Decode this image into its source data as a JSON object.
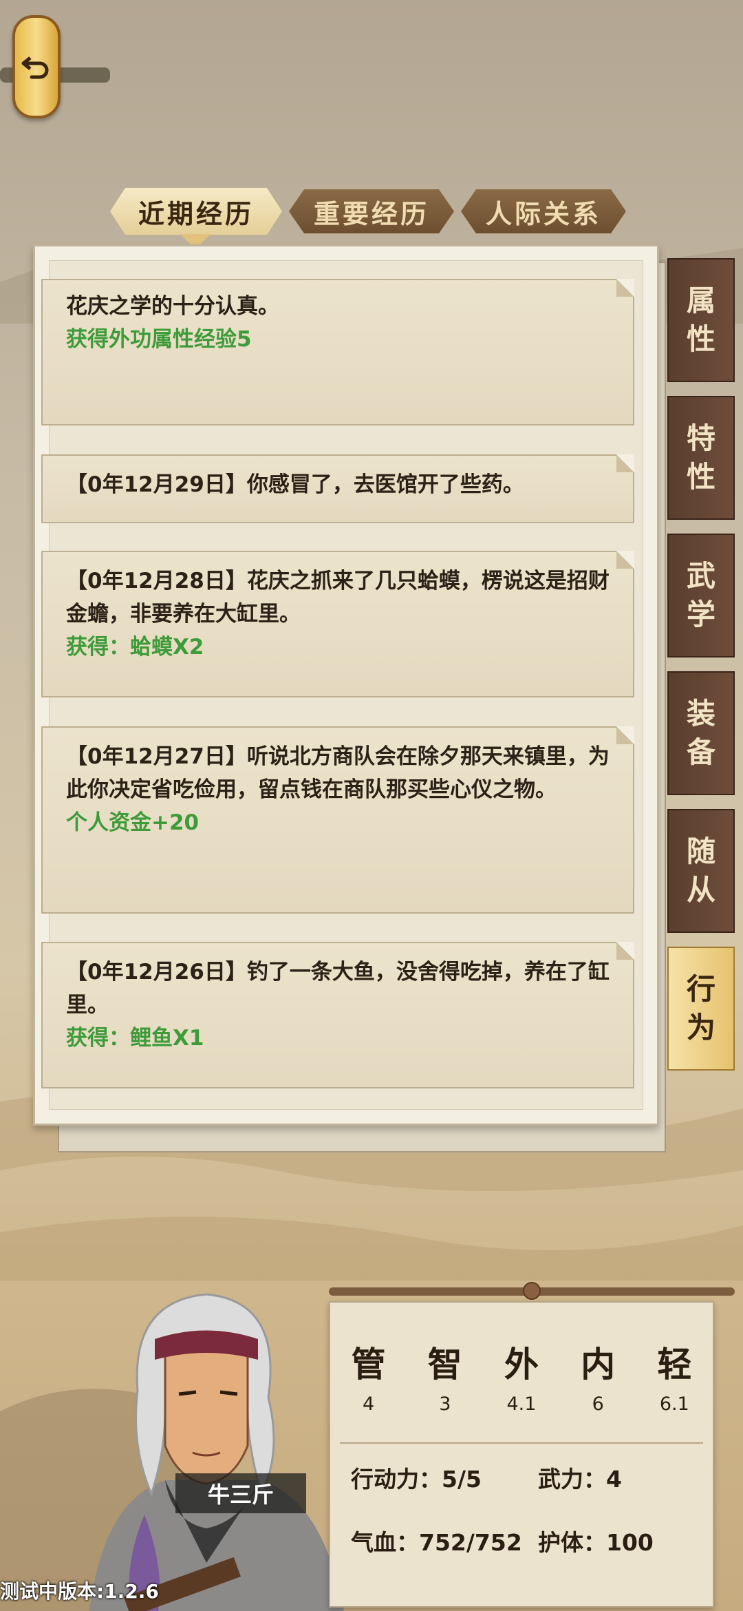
{
  "top_tabs": [
    "近期经历",
    "重要经历",
    "人际关系"
  ],
  "active_tab": "近期经历",
  "entries": [
    {
      "text": "花庆之学的十分认真。",
      "reward": "获得外功属性经验5"
    },
    {
      "text": "【0年12月29日】你感冒了，去医馆开了些药。",
      "reward": ""
    },
    {
      "text": "【0年12月28日】花庆之抓来了几只蛤蟆，楞说这是招财金蟾，非要养在大缸里。",
      "reward": "获得：蛤蟆X2"
    },
    {
      "text": "【0年12月27日】听说北方商队会在除夕那天来镇里，为此你决定省吃俭用，留点钱在商队那买些心仪之物。",
      "reward": "个人资金+20"
    },
    {
      "text": "【0年12月26日】钓了一条大鱼，没舍得吃掉，养在了缸里。",
      "reward": "获得：鲤鱼X1"
    }
  ],
  "side_tabs": [
    {
      "label": "属性",
      "chars": [
        "属",
        "性"
      ]
    },
    {
      "label": "特性",
      "chars": [
        "特",
        "性"
      ]
    },
    {
      "label": "武学",
      "chars": [
        "武",
        "学"
      ]
    },
    {
      "label": "装备",
      "chars": [
        "装",
        "备"
      ]
    },
    {
      "label": "随从",
      "chars": [
        "随",
        "从"
      ]
    },
    {
      "label": "行为",
      "chars": [
        "行",
        "为"
      ]
    }
  ],
  "active_side_tab": "行为",
  "stats": {
    "columns": [
      {
        "name": "管",
        "value": "4"
      },
      {
        "name": "智",
        "value": "3"
      },
      {
        "name": "外",
        "value": "4.1"
      },
      {
        "name": "内",
        "value": "6"
      },
      {
        "name": "轻",
        "value": "6.1"
      }
    ],
    "action_power": "行动力：5/5",
    "martial_power": "武力：4",
    "hp": "气血：752/752",
    "guard": "护体：100"
  },
  "character_name": "牛三斤",
  "version_text": "测试中版本:1.2.6",
  "colors": {
    "reward_green": "#3e9b39",
    "panel_bg": "#f4efe3",
    "tab_dark": "#6d4f30",
    "tab_active": "#e3cf98"
  }
}
